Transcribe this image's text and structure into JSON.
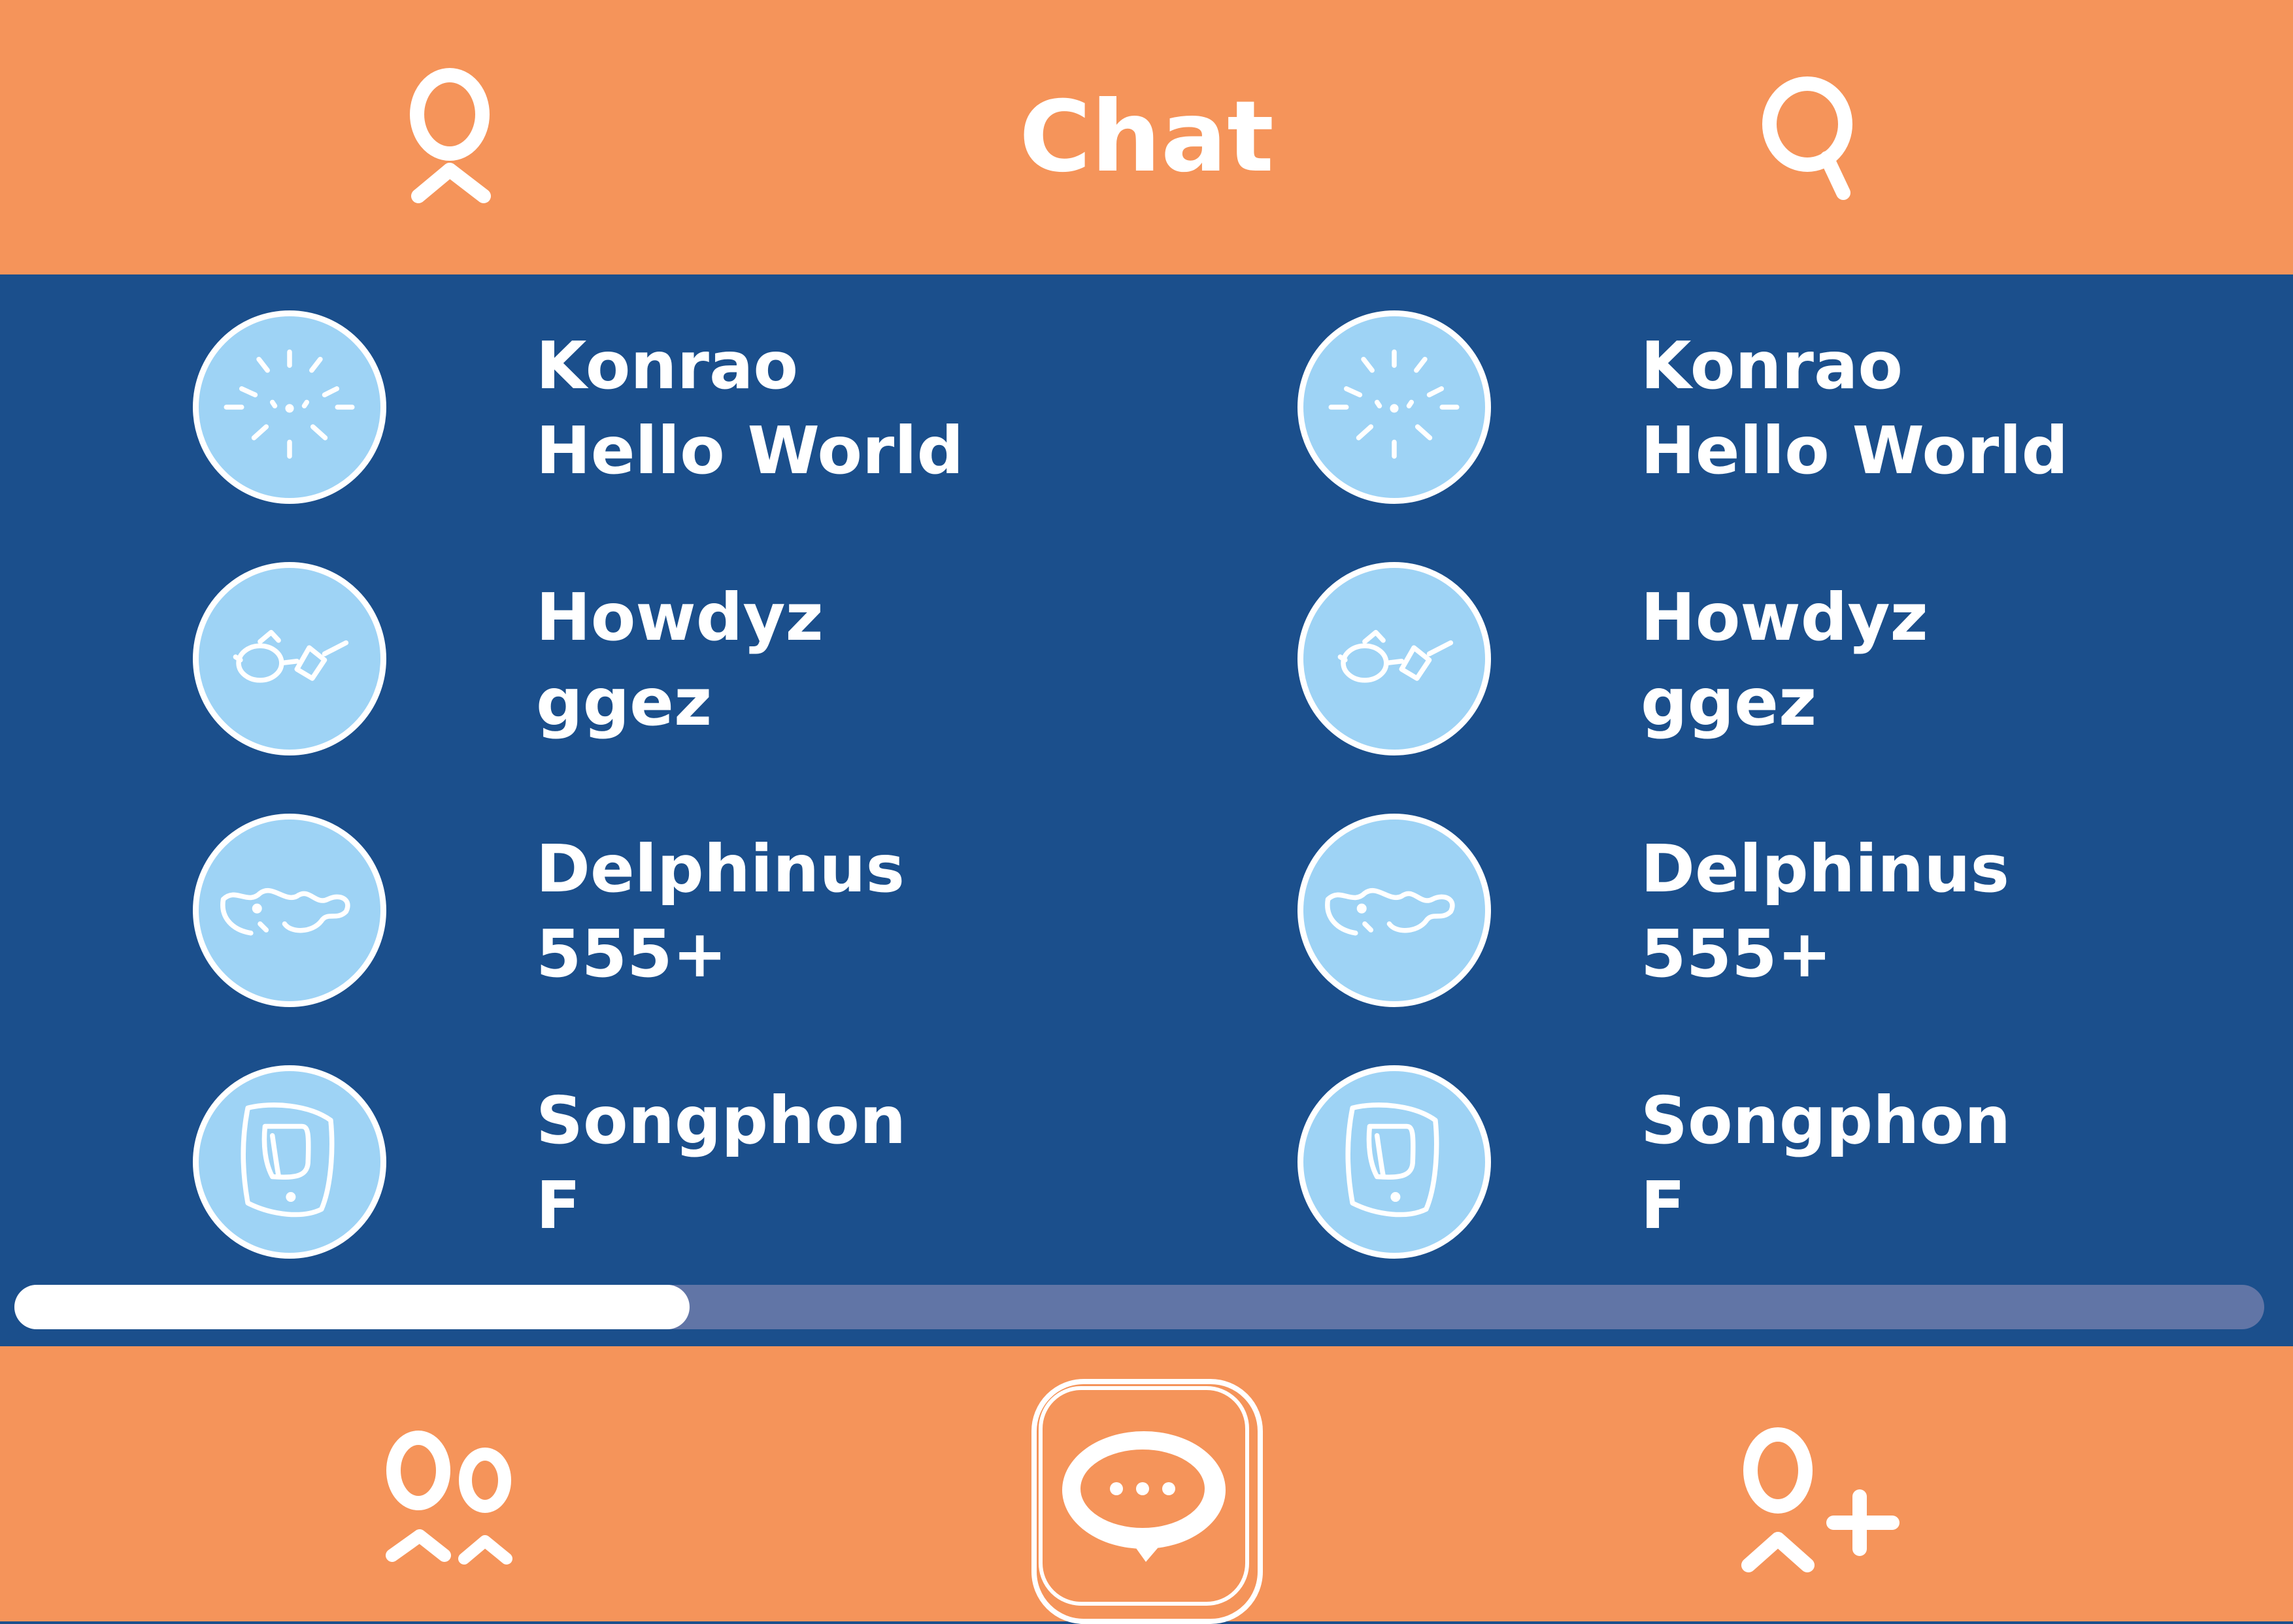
{
  "header": {
    "title": "Chat",
    "profile_icon": "profile-icon",
    "search_icon": "search-icon"
  },
  "chats": [
    {
      "name": "Konrao",
      "message": "Hello World",
      "avatar_icon": "sun-avatar-icon"
    },
    {
      "name": "Howdyz",
      "message": "ggez",
      "avatar_icon": "glasses-avatar-icon"
    },
    {
      "name": "Delphinus",
      "message": "555+",
      "avatar_icon": "dolphin-avatar-icon"
    },
    {
      "name": "Songphon",
      "message": "F",
      "avatar_icon": "phone-avatar-icon"
    },
    {
      "name": "Konrao",
      "message": "Hello World",
      "avatar_icon": "sun-avatar-icon"
    },
    {
      "name": "Howdyz",
      "message": "ggez",
      "avatar_icon": "glasses-avatar-icon"
    },
    {
      "name": "Delphinus",
      "message": "555+",
      "avatar_icon": "dolphin-avatar-icon"
    },
    {
      "name": "Songphon",
      "message": "F",
      "avatar_icon": "phone-avatar-icon"
    }
  ],
  "scrollbar": {
    "position_fraction": 0.3
  },
  "bottom_nav": {
    "friends_icon": "friends-icon",
    "chat_icon": "chat-bubble-icon",
    "add_friend_icon": "add-friend-icon",
    "active_tab": "chat"
  },
  "colors": {
    "bar_orange": "#f5945a",
    "list_blue": "#1b4f8c",
    "avatar_blue": "#9ed3f5",
    "scroll_track": "#6175a6",
    "white": "#ffffff"
  }
}
